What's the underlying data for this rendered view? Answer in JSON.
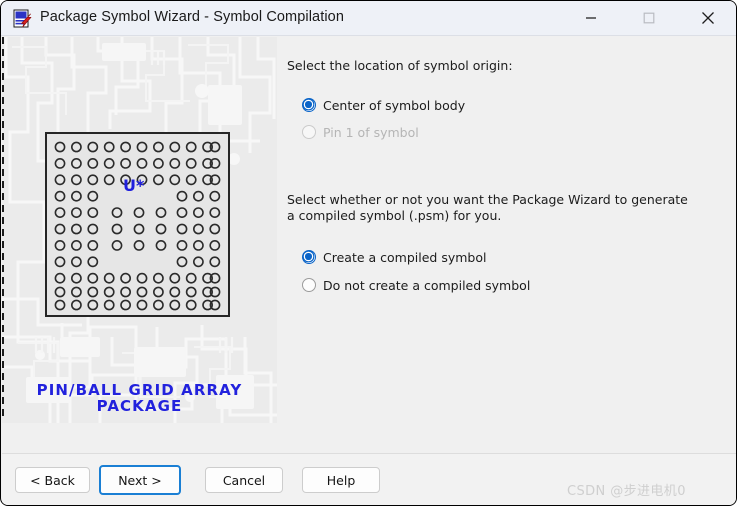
{
  "window": {
    "title": "Package Symbol Wizard - Symbol Compilation",
    "icon": "package-wizard-icon",
    "controls": {
      "minimize": "minimize-icon",
      "maximize": "maximize-icon",
      "close": "close-icon"
    }
  },
  "illustration": {
    "body_label": "U*",
    "caption_line1": "PIN/BALL GRID ARRAY",
    "caption_line2": "PACKAGE",
    "caption_color": "#2222dd",
    "label_color": "#2020dd",
    "grid": {
      "columns": 11,
      "rows": 11,
      "description": "pin/ball grid array pad matrix with hollow center and 3x3 inner cluster"
    }
  },
  "content": {
    "prompt_origin": "Select the location of symbol origin:",
    "origin_options": [
      {
        "label": "Center of symbol body",
        "checked": true,
        "disabled": false
      },
      {
        "label": "Pin 1 of symbol",
        "checked": false,
        "disabled": true
      }
    ],
    "prompt_compile": "Select whether or not you want the Package Wizard to generate a compiled symbol (.psm) for you.",
    "compile_options": [
      {
        "label": "Create a compiled symbol",
        "checked": true,
        "disabled": false
      },
      {
        "label": "Do not create a compiled symbol",
        "checked": false,
        "disabled": false
      }
    ]
  },
  "footer": {
    "back_label": "< Back",
    "next_label": "Next >",
    "cancel_label": "Cancel",
    "help_label": "Help",
    "focus_accent": "#1a7fd4"
  },
  "watermark": "CSDN @步进电机0"
}
